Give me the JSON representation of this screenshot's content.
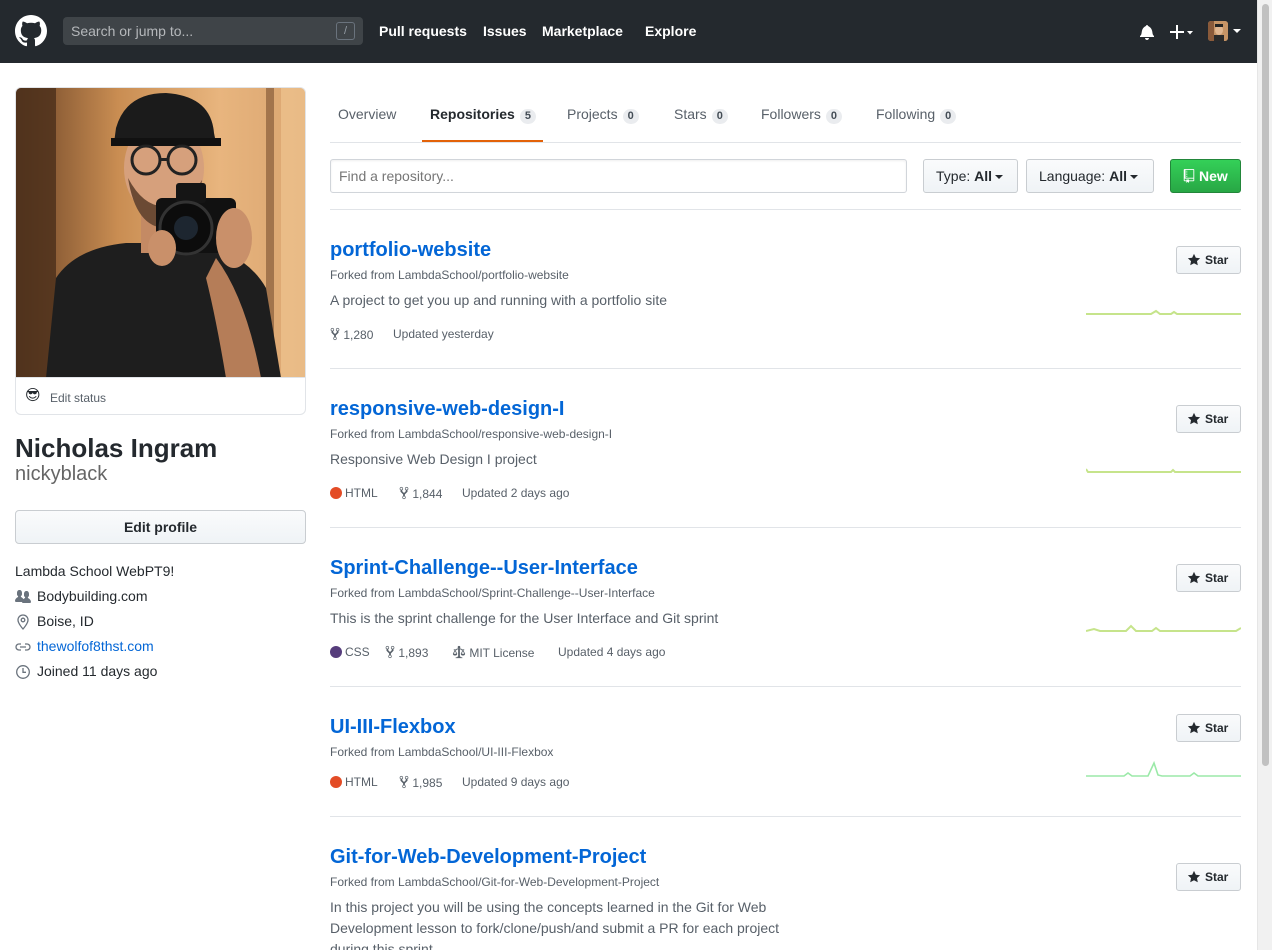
{
  "header": {
    "search_placeholder": "Search or jump to...",
    "slash_key": "/",
    "nav": [
      "Pull requests",
      "Issues",
      "Marketplace",
      "Explore"
    ]
  },
  "profile": {
    "edit_status": "Edit status",
    "status_emoji": "😎",
    "full_name": "Nicholas Ingram",
    "username": "nickyblack",
    "edit_profile": "Edit profile",
    "bio": "Lambda School WebPT9!",
    "company": "Bodybuilding.com",
    "location": "Boise, ID",
    "website": "thewolfof8thst.com",
    "joined": "Joined 11 days ago"
  },
  "tabs": [
    {
      "label": "Overview",
      "count": null
    },
    {
      "label": "Repositories",
      "count": "5"
    },
    {
      "label": "Projects",
      "count": "0"
    },
    {
      "label": "Stars",
      "count": "0"
    },
    {
      "label": "Followers",
      "count": "0"
    },
    {
      "label": "Following",
      "count": "0"
    }
  ],
  "filter": {
    "placeholder": "Find a repository...",
    "type_label": "Type:",
    "type_value": "All",
    "language_label": "Language:",
    "language_value": "All",
    "new_label": "New"
  },
  "colors": {
    "accent_orange": "#e36209",
    "link_blue": "#0366d6",
    "new_green": "#28a745",
    "html": "#e34c26",
    "css": "#563d7c",
    "sparkline": "#c6e48b"
  },
  "star_label": "Star",
  "repos": [
    {
      "name": "portfolio-website",
      "fork": "Forked from LambdaSchool/portfolio-website",
      "description": "A project to get you up and running with a portfolio site",
      "language": "",
      "forks": "1,280",
      "license": "",
      "updated": "Updated yesterday"
    },
    {
      "name": "responsive-web-design-I",
      "fork": "Forked from LambdaSchool/responsive-web-design-I",
      "description": "Responsive Web Design I project",
      "language": "HTML",
      "forks": "1,844",
      "license": "",
      "updated": "Updated 2 days ago"
    },
    {
      "name": "Sprint-Challenge--User-Interface",
      "fork": "Forked from LambdaSchool/Sprint-Challenge--User-Interface",
      "description": "This is the sprint challenge for the User Interface and Git sprint",
      "language": "CSS",
      "forks": "1,893",
      "license": "MIT License",
      "updated": "Updated 4 days ago"
    },
    {
      "name": "UI-III-Flexbox",
      "fork": "Forked from LambdaSchool/UI-III-Flexbox",
      "description": "",
      "language": "HTML",
      "forks": "1,985",
      "license": "",
      "updated": "Updated 9 days ago"
    },
    {
      "name": "Git-for-Web-Development-Project",
      "fork": "Forked from LambdaSchool/Git-for-Web-Development-Project",
      "description": "In this project you will be using the concepts learned in the Git for Web Development lesson to fork/clone/push/and submit a PR for each project during this sprint.",
      "language": "",
      "forks": "",
      "license": "",
      "updated": ""
    }
  ]
}
